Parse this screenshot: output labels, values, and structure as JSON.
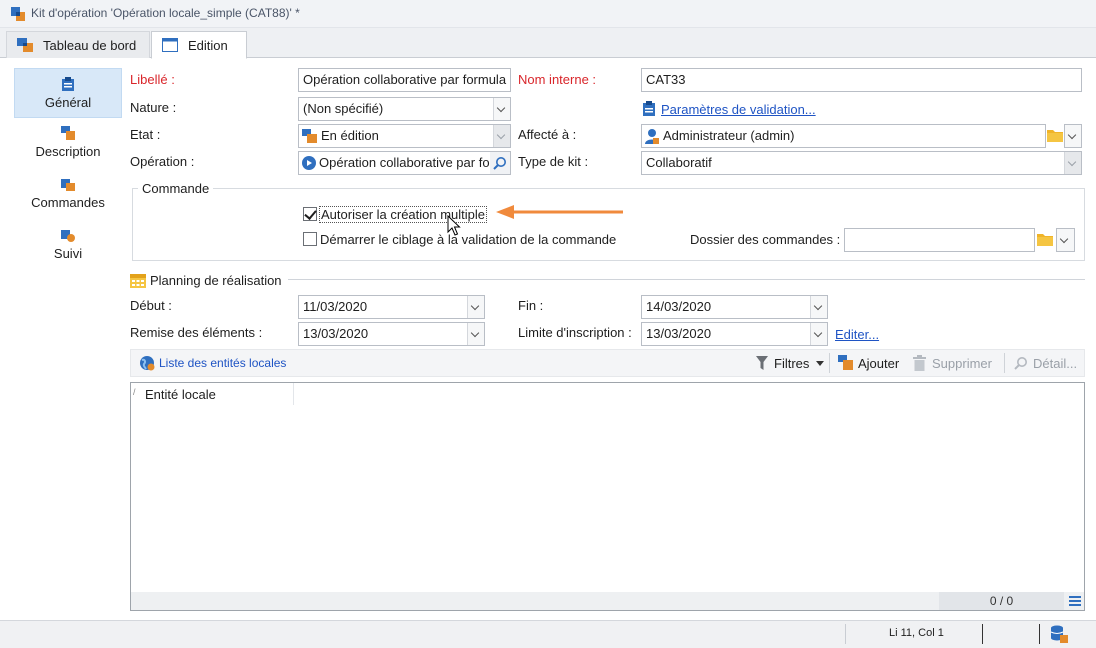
{
  "window": {
    "title": "Kit d'opération 'Opération locale_simple (CAT88)' *"
  },
  "tabs": [
    {
      "label": "Tableau de bord"
    },
    {
      "label": "Edition"
    }
  ],
  "sidebar": {
    "items": [
      {
        "label": "Général"
      },
      {
        "label": "Description"
      },
      {
        "label": "Commandes"
      },
      {
        "label": "Suivi"
      }
    ]
  },
  "form": {
    "libelle": {
      "label": "Libellé :",
      "value": "Opération collaborative par formula"
    },
    "nom_interne": {
      "label": "Nom interne :",
      "value": "CAT33"
    },
    "nature": {
      "label": "Nature :",
      "value": "(Non spécifié)"
    },
    "parametres_link": "Paramètres de validation...",
    "etat": {
      "label": "Etat :",
      "value": "En édition"
    },
    "affecte": {
      "label": "Affecté à :",
      "value": "Administrateur (admin)"
    },
    "operation": {
      "label": "Opération :",
      "value": "Opération collaborative par fo"
    },
    "type_kit": {
      "label": "Type de kit :",
      "value": "Collaboratif"
    }
  },
  "commande": {
    "title": "Commande",
    "checkbox_multiple": {
      "label": "Autoriser la création multiple",
      "checked": true
    },
    "checkbox_ciblage": {
      "label": "Démarrer le ciblage à la validation de la commande",
      "checked": false
    },
    "dossier_label": "Dossier des commandes :",
    "dossier_value": ""
  },
  "planning": {
    "title": "Planning de réalisation",
    "debut": {
      "label": "Début :",
      "value": "11/03/2020"
    },
    "fin": {
      "label": "Fin :",
      "value": "14/03/2020"
    },
    "remise": {
      "label": "Remise des éléments :",
      "value": "13/03/2020"
    },
    "limite": {
      "label": "Limite d'inscription :",
      "value": "13/03/2020"
    },
    "editer_link": "Editer..."
  },
  "list": {
    "title": "Liste des entités locales",
    "filters": "Filtres",
    "add": "Ajouter",
    "delete": "Supprimer",
    "detail": "Détail...",
    "column": "Entité locale",
    "counter": "0 / 0"
  },
  "status": {
    "position": "Li 11, Col 1"
  },
  "colors": {
    "accent_arrow": "#f08a3c",
    "required_label": "#d9262b",
    "link": "#1f54c4",
    "selection": "#d8e8f8"
  },
  "icons": [
    "kit-icon",
    "dashboard-icon",
    "edition-icon",
    "clipboard-icon",
    "user-icon",
    "play-icon",
    "search-icon",
    "folder-icon",
    "calendar-icon",
    "globe-icon",
    "filter-icon",
    "delete-icon",
    "database-icon"
  ]
}
